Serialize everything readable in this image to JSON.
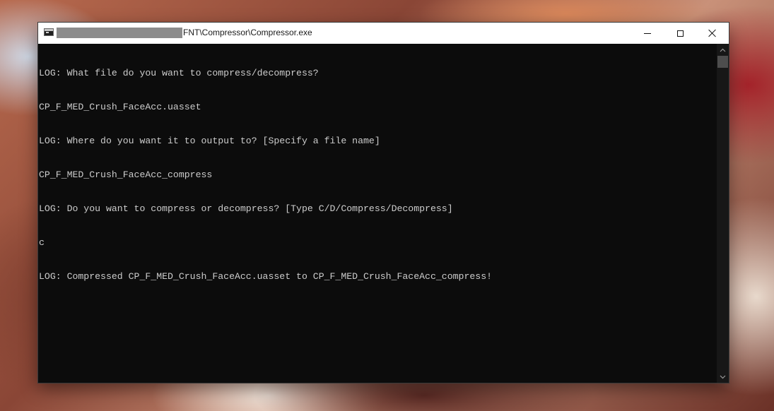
{
  "window": {
    "title": "FNT\\Compressor\\Compressor.exe",
    "controls": {
      "minimize": "minimize",
      "maximize": "maximize",
      "close": "close"
    }
  },
  "console": {
    "lines": [
      "LOG: What file do you want to compress/decompress?",
      "CP_F_MED_Crush_FaceAcc.uasset",
      "LOG: Where do you want it to output to? [Specify a file name]",
      "CP_F_MED_Crush_FaceAcc_compress",
      "LOG: Do you want to compress or decompress? [Type C/D/Compress/Decompress]",
      "c",
      "LOG: Compressed CP_F_MED_Crush_FaceAcc.uasset to CP_F_MED_Crush_FaceAcc_compress!"
    ]
  },
  "icons": {
    "app": "console-app-icon",
    "minimize": "minimize-icon",
    "maximize": "maximize-icon",
    "close": "close-icon",
    "scroll_up": "chevron-up-icon",
    "scroll_down": "chevron-down-icon"
  },
  "colors": {
    "console_bg": "#0c0c0c",
    "console_text": "#cccccc",
    "titlebar_bg": "#ffffff",
    "redaction": "#8c8c8c"
  }
}
